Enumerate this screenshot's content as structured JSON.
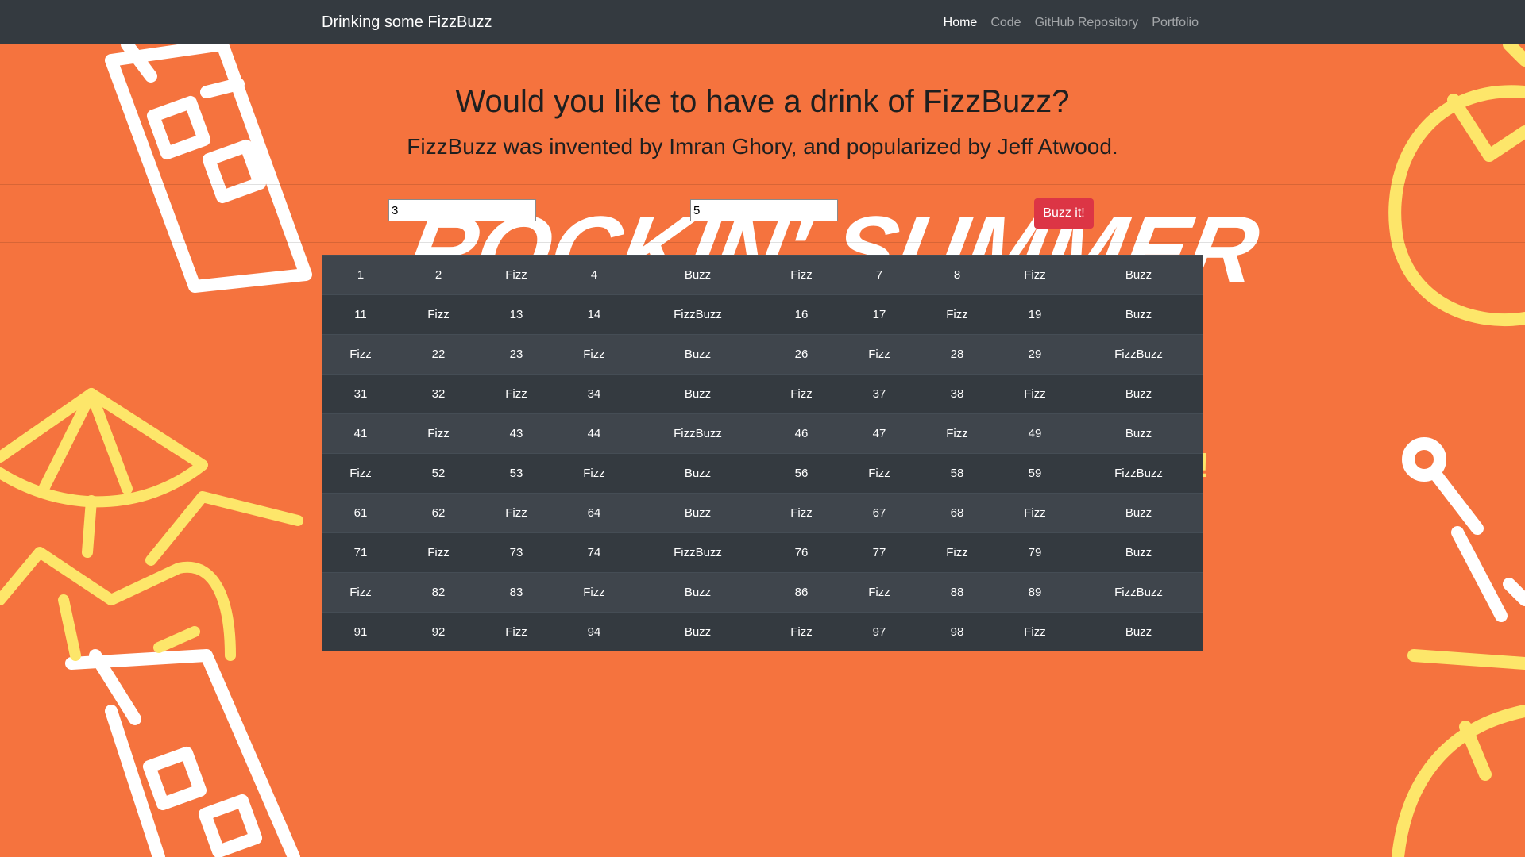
{
  "navbar": {
    "brand": "Drinking some FizzBuzz",
    "links": [
      {
        "label": "Home",
        "active": true
      },
      {
        "label": "Code",
        "active": false
      },
      {
        "label": "GitHub Repository",
        "active": false
      },
      {
        "label": "Portfolio",
        "active": false
      }
    ]
  },
  "hero": {
    "title": "Would you like to have a drink of FizzBuzz?",
    "subtitle": "FizzBuzz was invented by Imran Ghory, and popularized by Jeff Atwood."
  },
  "form": {
    "fizz_value": "3",
    "buzz_value": "5",
    "button_label": "Buzz it!"
  },
  "results": [
    [
      "1",
      "2",
      "Fizz",
      "4",
      "Buzz",
      "Fizz",
      "7",
      "8",
      "Fizz",
      "Buzz"
    ],
    [
      "11",
      "Fizz",
      "13",
      "14",
      "FizzBuzz",
      "16",
      "17",
      "Fizz",
      "19",
      "Buzz"
    ],
    [
      "Fizz",
      "22",
      "23",
      "Fizz",
      "Buzz",
      "26",
      "Fizz",
      "28",
      "29",
      "FizzBuzz"
    ],
    [
      "31",
      "32",
      "Fizz",
      "34",
      "Buzz",
      "Fizz",
      "37",
      "38",
      "Fizz",
      "Buzz"
    ],
    [
      "41",
      "Fizz",
      "43",
      "44",
      "FizzBuzz",
      "46",
      "47",
      "Fizz",
      "49",
      "Buzz"
    ],
    [
      "Fizz",
      "52",
      "53",
      "Fizz",
      "Buzz",
      "56",
      "Fizz",
      "58",
      "59",
      "FizzBuzz"
    ],
    [
      "61",
      "62",
      "Fizz",
      "64",
      "Buzz",
      "Fizz",
      "67",
      "68",
      "Fizz",
      "Buzz"
    ],
    [
      "71",
      "Fizz",
      "73",
      "74",
      "FizzBuzz",
      "76",
      "77",
      "Fizz",
      "79",
      "Buzz"
    ],
    [
      "Fizz",
      "82",
      "83",
      "Fizz",
      "Buzz",
      "86",
      "Fizz",
      "88",
      "89",
      "FizzBuzz"
    ],
    [
      "91",
      "92",
      "Fizz",
      "94",
      "Buzz",
      "Fizz",
      "97",
      "98",
      "Fizz",
      "Buzz"
    ]
  ],
  "colors": {
    "background": "#f5733e",
    "navbar": "#343a40",
    "button": "#dc3545",
    "art_white": "#ffffff",
    "art_yellow": "#fde66a"
  }
}
